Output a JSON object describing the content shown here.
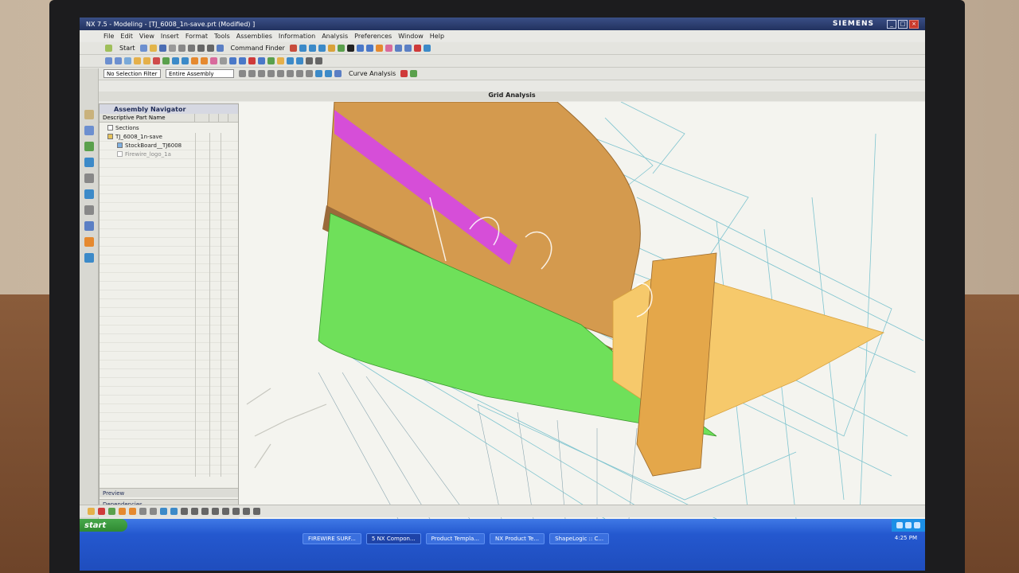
{
  "window": {
    "title": "NX 7.5 - Modeling - [TJ_6008_1n-save.prt (Modified) ]",
    "brand": "SIEMENS",
    "minimize": "_",
    "maximize": "□",
    "close": "×"
  },
  "menubar": {
    "items": [
      "File",
      "Edit",
      "View",
      "Insert",
      "Format",
      "Tools",
      "Assemblies",
      "Information",
      "Analysis",
      "Preferences",
      "Window",
      "Help"
    ]
  },
  "toolbar": {
    "start_label": "Start",
    "command_finder_label": "Command Finder",
    "selection_filter": "No Selection Filter",
    "assembly_scope": "Entire Assembly",
    "curve_analysis_label": "Curve Analysis"
  },
  "grid_analysis_title": "Grid Analysis",
  "assembly_navigator": {
    "title": "Assembly Navigator",
    "columns": [
      "Descriptive Part Name"
    ],
    "rows": [
      {
        "label": "Sections"
      },
      {
        "label": "TJ_6008_1n-save"
      },
      {
        "label": "StockBoard__TJ6008"
      },
      {
        "label": "Firewire_logo_1a"
      }
    ],
    "preview_label": "Preview",
    "dependencies_label": "Dependencies"
  },
  "taskbar": {
    "start_label": "start",
    "tasks": [
      {
        "label": "FIREWIRE SURF..."
      },
      {
        "label": "5 NX Compon..."
      },
      {
        "label": "Product Templa..."
      },
      {
        "label": "NX Product Te..."
      },
      {
        "label": "ShapeLogic :: C..."
      }
    ],
    "clock": "4:25 PM"
  },
  "colors": {
    "surface_orange": "#d49a4e",
    "surface_green": "#6fe05a",
    "surface_magenta": "#d64ed8",
    "surface_light_orange": "#f6c96b",
    "wire_cyan": "#7fc4cf",
    "xp_blue": "#2458cf"
  }
}
